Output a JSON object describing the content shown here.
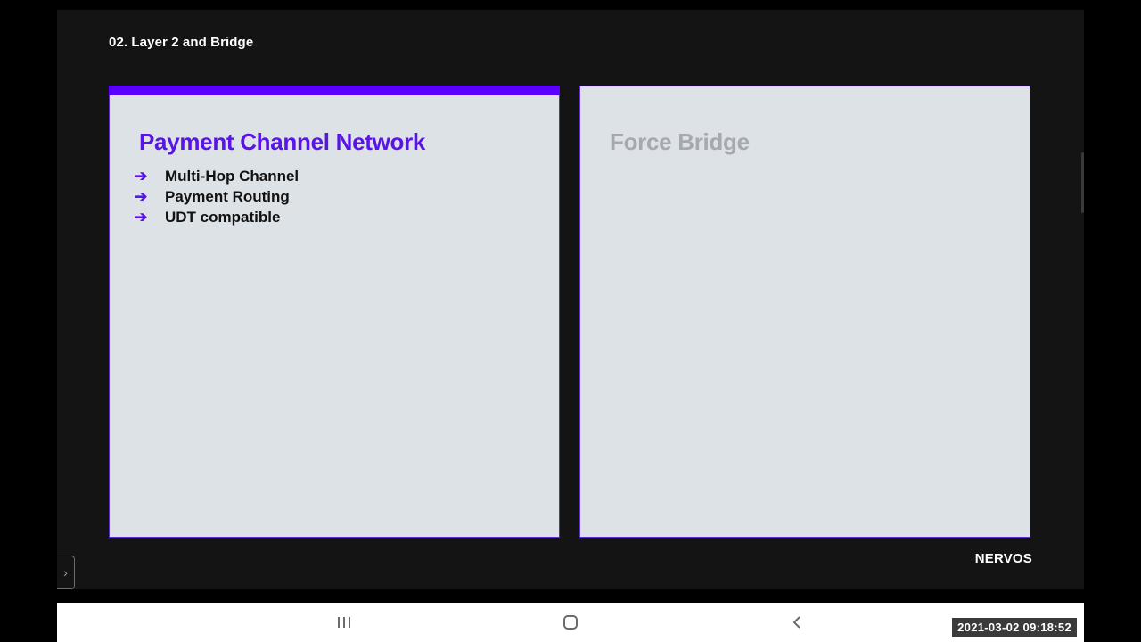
{
  "slide": {
    "section_title": "02. Layer 2 and Bridge",
    "brand": "NERVOS",
    "cards": [
      {
        "title": "Payment Channel Network",
        "bullets": [
          "Multi-Hop Channel",
          "Payment Routing",
          "UDT compatible"
        ]
      },
      {
        "title": "Force Bridge",
        "bullets": []
      }
    ]
  },
  "icons": {
    "bullet": "arrow-right-icon",
    "side_toggle": "chevron-right-icon",
    "nav_recent": "recent-apps-icon",
    "nav_home": "home-icon",
    "nav_back": "back-icon"
  },
  "overlay": {
    "timestamp": "2021-03-02 09:18:52"
  },
  "colors": {
    "accent": "#5a00ff",
    "card_bg": "#dde2e6",
    "slide_bg": "#141414",
    "muted_title": "#a6a9ad"
  }
}
